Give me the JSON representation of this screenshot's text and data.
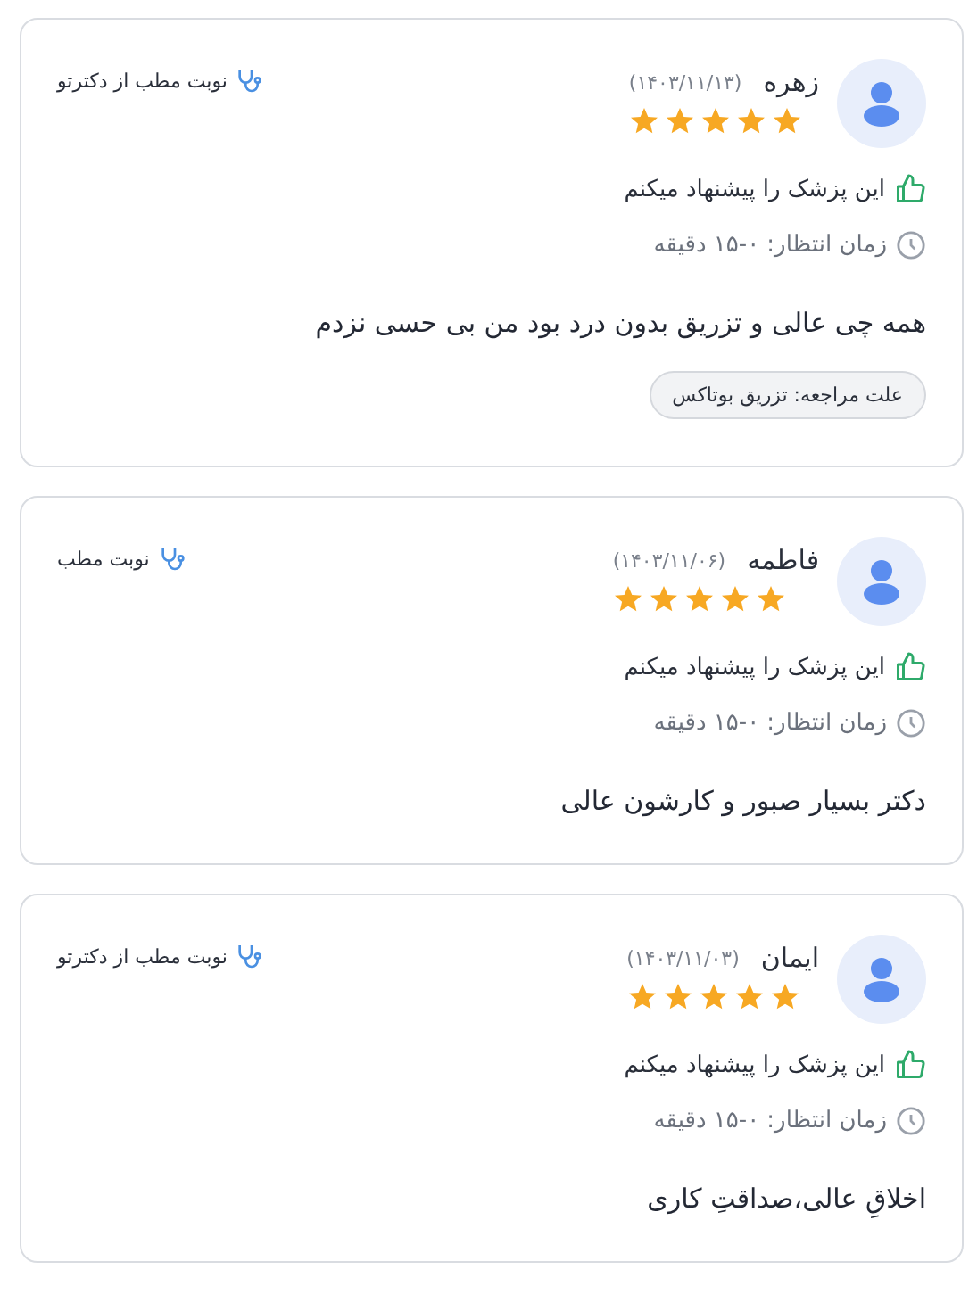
{
  "reviews": [
    {
      "name": "زهره",
      "date": "(۱۴۰۳/۱۱/۱۳)",
      "stars": 5,
      "booking": "نوبت مطب از دکترتو",
      "recommend": "این پزشک را پیشنهاد میکنم",
      "wait_time": "زمان انتظار: ۰-۱۵ دقیقه",
      "comment": "همه چی عالی و تزریق بدون درد بود من بی حسی نزدم",
      "visit_reason": "علت مراجعه: تزریق بوتاکس"
    },
    {
      "name": "فاطمه",
      "date": "(۱۴۰۳/۱۱/۰۶)",
      "stars": 5,
      "booking": "نوبت مطب",
      "recommend": "این پزشک را پیشنهاد میکنم",
      "wait_time": "زمان انتظار: ۰-۱۵ دقیقه",
      "comment": "دکتر بسیار صبور و کارشون عالی"
    },
    {
      "name": "ایمان",
      "date": "(۱۴۰۳/۱۱/۰۳)",
      "stars": 5,
      "booking": "نوبت مطب از دکترتو",
      "recommend": "این پزشک را پیشنهاد میکنم",
      "wait_time": "زمان انتظار: ۰-۱۵ دقیقه",
      "comment": "اخلاقِ عالی،صداقتِ کاری"
    }
  ]
}
